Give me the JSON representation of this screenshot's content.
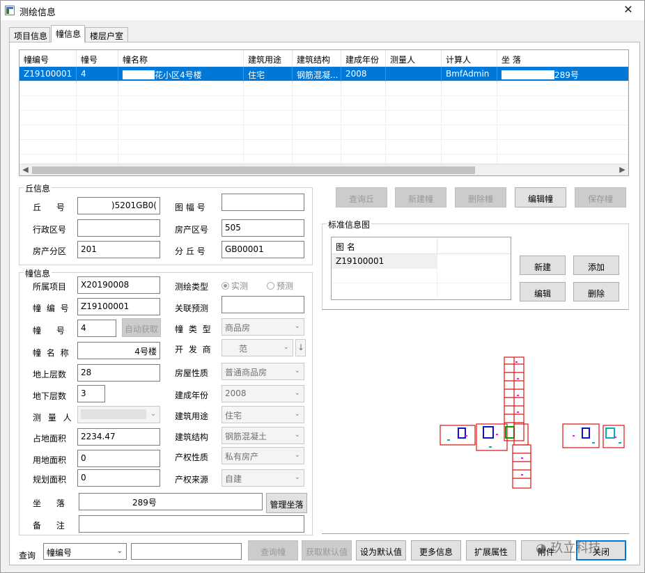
{
  "window": {
    "title": "测绘信息",
    "close_glyph": "✕"
  },
  "tabs": [
    {
      "label": "项目信息"
    },
    {
      "label": "幢信息"
    },
    {
      "label": "楼层户室"
    }
  ],
  "grid": {
    "columns": [
      "幢编号",
      "幢号",
      "幢名称",
      "建筑用途",
      "建筑结构",
      "建成年份",
      "测量人",
      "计算人",
      "坐 落"
    ],
    "rows": [
      {
        "building_code": "Z19100001",
        "building_no": "4",
        "building_name": "花小区4号楼",
        "usage": "住宅",
        "structure": "钢筋混凝...",
        "year": "2008",
        "surveyor": "",
        "calculator": "BmfAdmin",
        "location": "289号"
      }
    ]
  },
  "parcel": {
    "title": "丘信息",
    "parcel_no_label": "丘 号",
    "parcel_no": ")5201GB0(",
    "sheet_no_label": "图 幅 号",
    "sheet_no": "",
    "admin_zone_label": "行政区号",
    "admin_zone": "",
    "property_zone_label": "房产区号",
    "property_zone": "505",
    "property_subzone_label": "房产分区",
    "property_subzone": "201",
    "sub_parcel_label": "分 丘 号",
    "sub_parcel": "GB00001"
  },
  "building": {
    "title": "幢信息",
    "project_label": "所属项目",
    "project": "X20190008",
    "survey_type_label": "测绘类型",
    "survey_actual": "实测",
    "survey_predict": "预测",
    "code_label": "幢 编 号",
    "code": "Z19100001",
    "related_label": "关联预测",
    "related": "",
    "no_label": "幢 号",
    "no": "4",
    "auto_button": "自动获取",
    "type_label": "幢 类 型",
    "type": "商品房",
    "name_label": "幢 名 称",
    "name": "4号楼",
    "developer_label": "开 发 商",
    "developer": "范",
    "above_label": "地上层数",
    "above": "28",
    "nature_label": "房屋性质",
    "nature": "普通商品房",
    "below_label": "地下层数",
    "below": "3",
    "year_label": "建成年份",
    "year": "2008",
    "surveyor_label": "测 量 人",
    "surveyor": "",
    "usage_label": "建筑用途",
    "usage": "住宅",
    "footprint_label": "占地面积",
    "footprint": "2234.47",
    "structure_label": "建筑结构",
    "structure": "钢筋混凝土",
    "land_area_label": "用地面积",
    "land_area": "0",
    "right_nature_label": "产权性质",
    "right_nature": "私有房产",
    "plan_area_label": "规划面积",
    "plan_area": "0",
    "right_source_label": "产权来源",
    "right_source": "自建",
    "location_label": "坐 落",
    "location": "289号",
    "manage_location_button": "管理坐落",
    "remark_label": "备 注",
    "remark": ""
  },
  "top_buttons": {
    "query_parcel": "查询丘",
    "new_building": "新建幢",
    "delete_building": "删除幢",
    "edit_building": "编辑幢",
    "save_building": "保存幢"
  },
  "drawings": {
    "title": "标准信息图",
    "col_name": "图 名",
    "rows": [
      {
        "name": "Z19100001"
      }
    ],
    "new": "新建",
    "add": "添加",
    "edit": "编辑",
    "delete": "删除"
  },
  "bottom": {
    "query_label": "查询",
    "field": "幢编号",
    "value": "",
    "query_button": "查询幢",
    "get_default": "获取默认值",
    "set_default": "设为默认值",
    "more_info": "更多信息",
    "ext_attr": "扩展属性",
    "attach": "附件",
    "close": "关闭"
  },
  "watermark": "玖立科技",
  "colors": {
    "selection": "#0078d7",
    "plan_red": "#e01010",
    "plan_blue": "#1010c8",
    "plan_magenta": "#e020e0",
    "plan_cyan": "#00b0c0",
    "plan_green": "#00a000"
  }
}
